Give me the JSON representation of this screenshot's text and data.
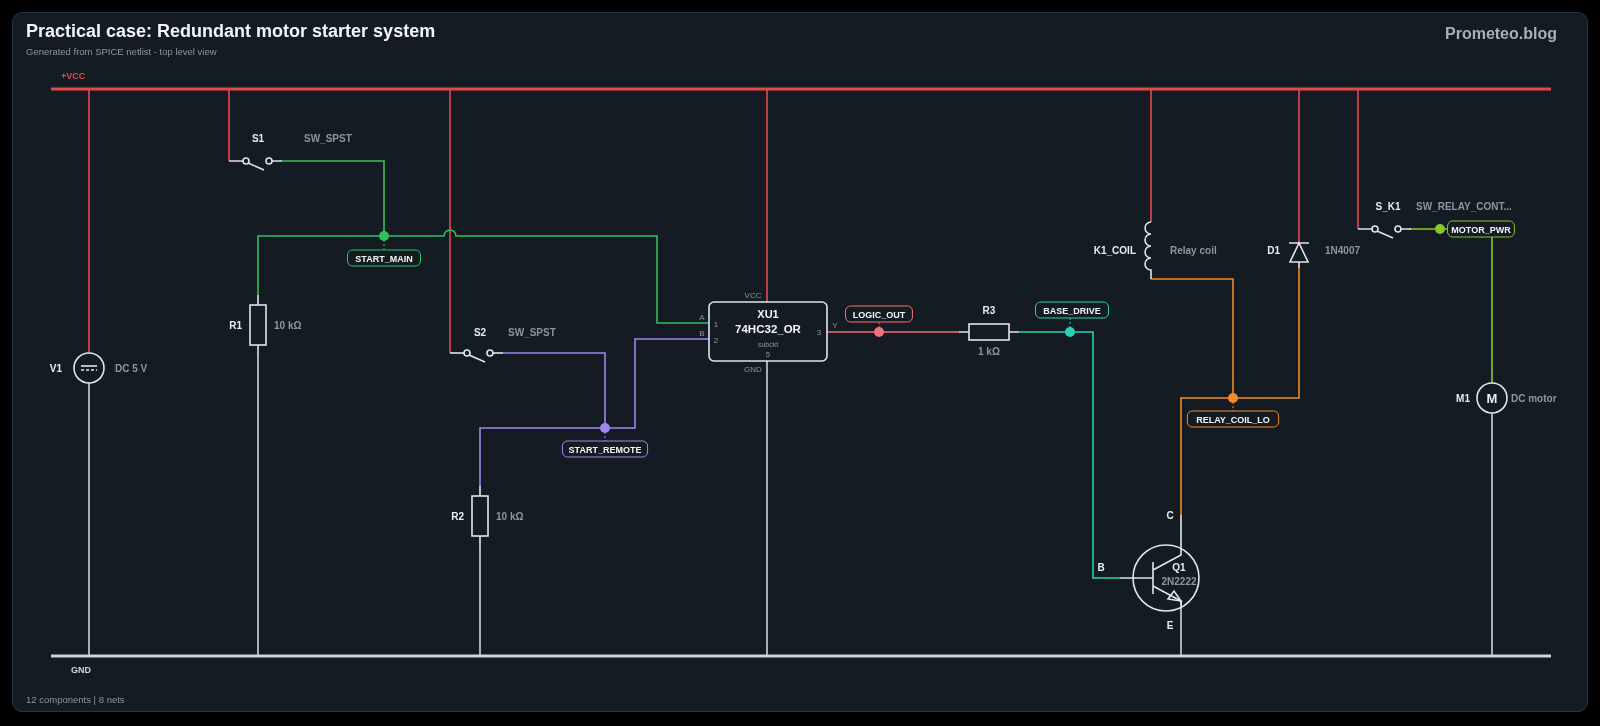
{
  "header": {
    "title": "Practical case: Redundant motor starter system",
    "subtitle": "Generated from SPICE netlist - top level view",
    "brand": "Prometeo.blog"
  },
  "schematic": {
    "rails": [
      {
        "kind": "supply",
        "label": "+VCC"
      },
      {
        "kind": "ground",
        "label": "GND"
      }
    ],
    "components": [
      {
        "kind": "source",
        "designator": "V1",
        "value": "DC 5 V"
      },
      {
        "kind": "switch",
        "designator": "S1",
        "value": "SW_SPST"
      },
      {
        "kind": "resistor",
        "designator": "R1",
        "value": "10 kΩ"
      },
      {
        "kind": "switch",
        "designator": "S2",
        "value": "SW_SPST"
      },
      {
        "kind": "resistor",
        "designator": "R2",
        "value": "10 kΩ"
      },
      {
        "kind": "ic",
        "designator": "XU1",
        "value": "74HC32_OR",
        "type": "subckt",
        "pins": [
          {
            "name": "VCC"
          },
          {
            "name": "A",
            "number": "1"
          },
          {
            "name": "B",
            "number": "2"
          },
          {
            "name": "Y",
            "number": "3"
          },
          {
            "name": "GND",
            "number": "5"
          }
        ]
      },
      {
        "kind": "resistor",
        "designator": "R3",
        "value": "1 kΩ"
      },
      {
        "kind": "coil",
        "designator": "K1_COIL",
        "value": "Relay coil"
      },
      {
        "kind": "diode",
        "designator": "D1",
        "value": "1N4007"
      },
      {
        "kind": "switch",
        "designator": "S_K1",
        "value": "SW_RELAY_CONT..."
      },
      {
        "kind": "transistor",
        "designator": "Q1",
        "value": "2N2222",
        "pins": [
          "B",
          "C",
          "E"
        ]
      },
      {
        "kind": "motor",
        "designator": "M1",
        "value": "DC motor",
        "symbol": "M"
      }
    ],
    "nets": [
      {
        "label": "START_MAIN",
        "color": "#2fc25b"
      },
      {
        "label": "START_REMOTE",
        "color": "#9f86f0"
      },
      {
        "label": "LOGIC_OUT",
        "color": "#f4707a"
      },
      {
        "label": "BASE_DRIVE",
        "color": "#2ccfb5"
      },
      {
        "label": "RELAY_COIL_LO",
        "color": "#f28a2a"
      },
      {
        "label": "MOTOR_PWR",
        "color": "#84c926"
      }
    ]
  },
  "footer": "12 components | 8 nets"
}
